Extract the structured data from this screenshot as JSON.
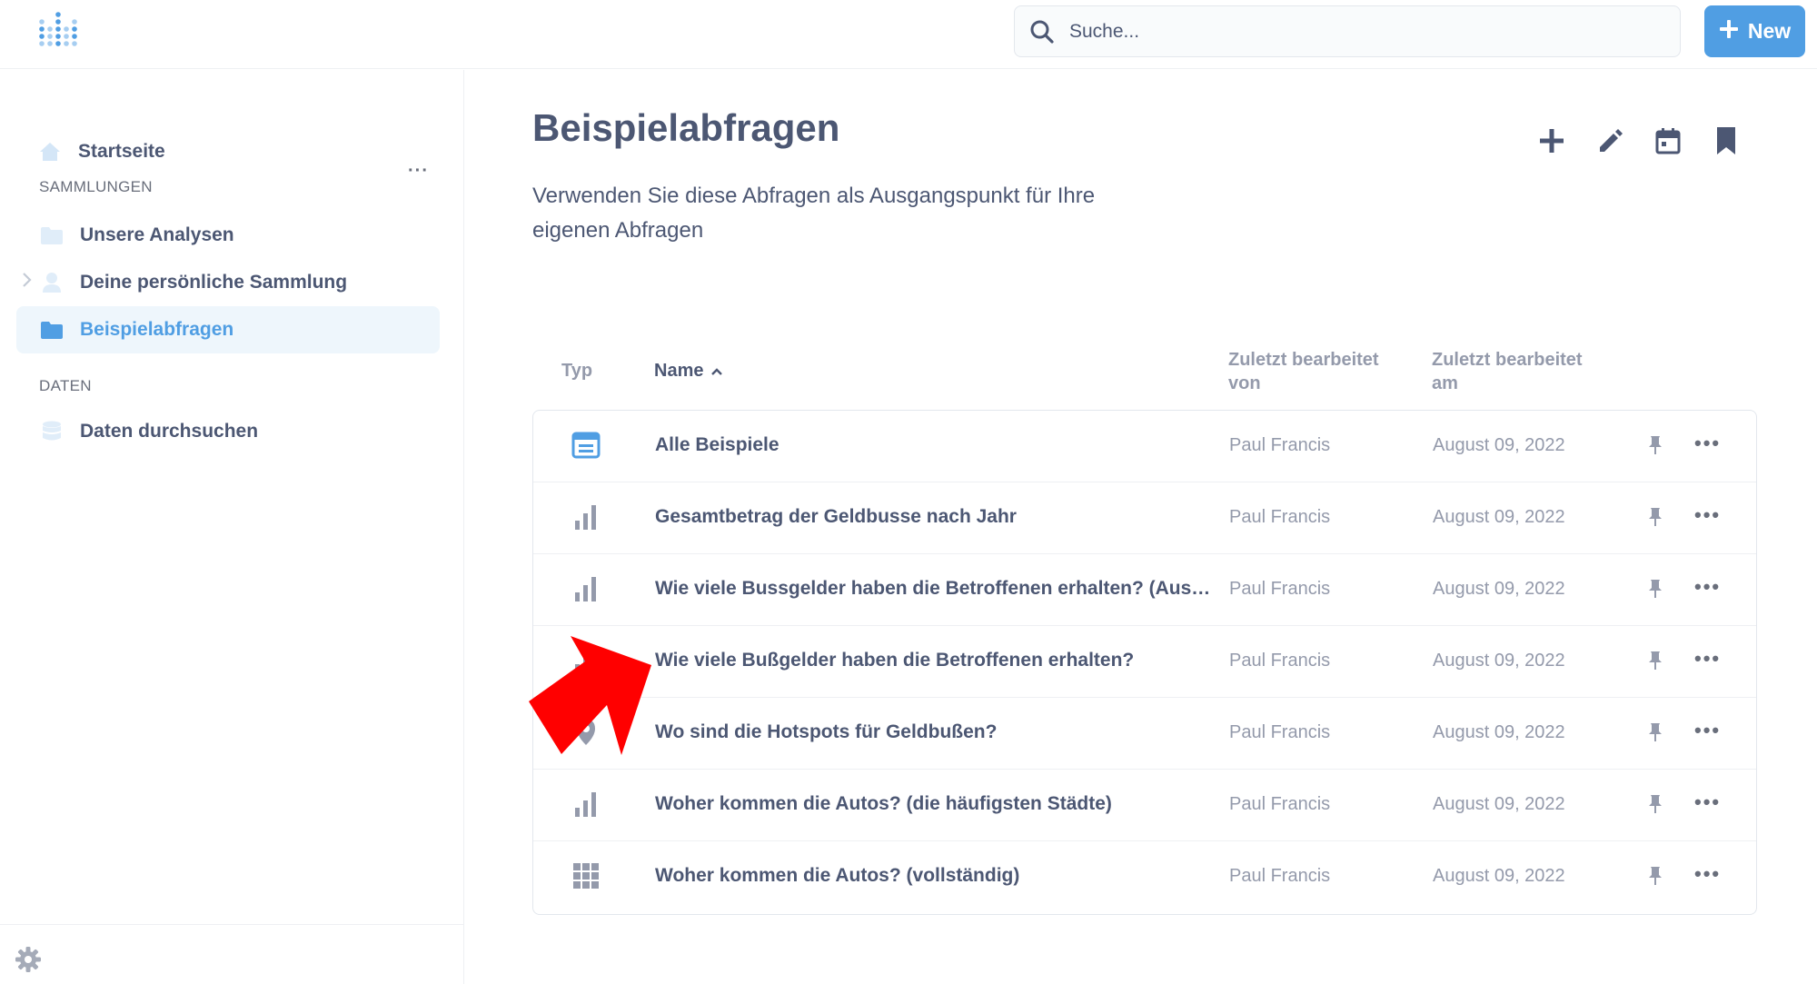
{
  "header": {
    "search_placeholder": "Suche...",
    "new_button_label": "New"
  },
  "sidebar": {
    "home_label": "Startseite",
    "collections_label": "SAMMLUNGEN",
    "collections_more": "···",
    "collections": [
      {
        "label": "Unsere Analysen",
        "icon": "folder-icon"
      },
      {
        "label": "Deine persönliche Sammlung",
        "icon": "person-icon"
      },
      {
        "label": "Beispielabfragen",
        "icon": "folder-icon",
        "active": true
      }
    ],
    "data_label": "DATEN",
    "browse_label": "Daten durchsuchen"
  },
  "page": {
    "title": "Beispielabfragen",
    "description": "Verwenden Sie diese Abfragen als Ausgangspunkt für Ihre eigenen Abfragen"
  },
  "table": {
    "headers": {
      "type": "Typ",
      "name": "Name",
      "edited_by": "Zuletzt bearbeitet von",
      "edited_at": "Zuletzt bearbeitet am"
    },
    "rows": [
      {
        "type_icon": "dashboard-icon",
        "name": "Alle Beispiele",
        "edited_by": "Paul Francis",
        "edited_at": "August 09, 2022"
      },
      {
        "type_icon": "bar-chart-icon",
        "name": "Gesamtbetrag der Geldbusse nach Jahr",
        "edited_by": "Paul Francis",
        "edited_at": "August 09, 2022"
      },
      {
        "type_icon": "bar-chart-icon",
        "name": "Wie viele Bussgelder haben die Betroffenen erhalten? (Ausf…",
        "edited_by": "Paul Francis",
        "edited_at": "August 09, 2022"
      },
      {
        "type_icon": "bar-chart-icon",
        "name": "Wie viele Bußgelder haben die Betroffenen erhalten?",
        "edited_by": "Paul Francis",
        "edited_at": "August 09, 2022"
      },
      {
        "type_icon": "map-pin-icon",
        "name": "Wo sind die Hotspots für Geldbußen?",
        "edited_by": "Paul Francis",
        "edited_at": "August 09, 2022"
      },
      {
        "type_icon": "bar-chart-icon",
        "name": "Woher kommen die Autos? (die häufigsten Städte)",
        "edited_by": "Paul Francis",
        "edited_at": "August 09, 2022"
      },
      {
        "type_icon": "table-icon",
        "name": "Woher kommen die Autos? (vollständig)",
        "edited_by": "Paul Francis",
        "edited_at": "August 09, 2022"
      }
    ],
    "more_label": "•••"
  },
  "colors": {
    "brand": "#509ee3",
    "text_dark": "#4c5773",
    "text_light": "#949aab",
    "annotation_arrow": "#ff0000"
  }
}
